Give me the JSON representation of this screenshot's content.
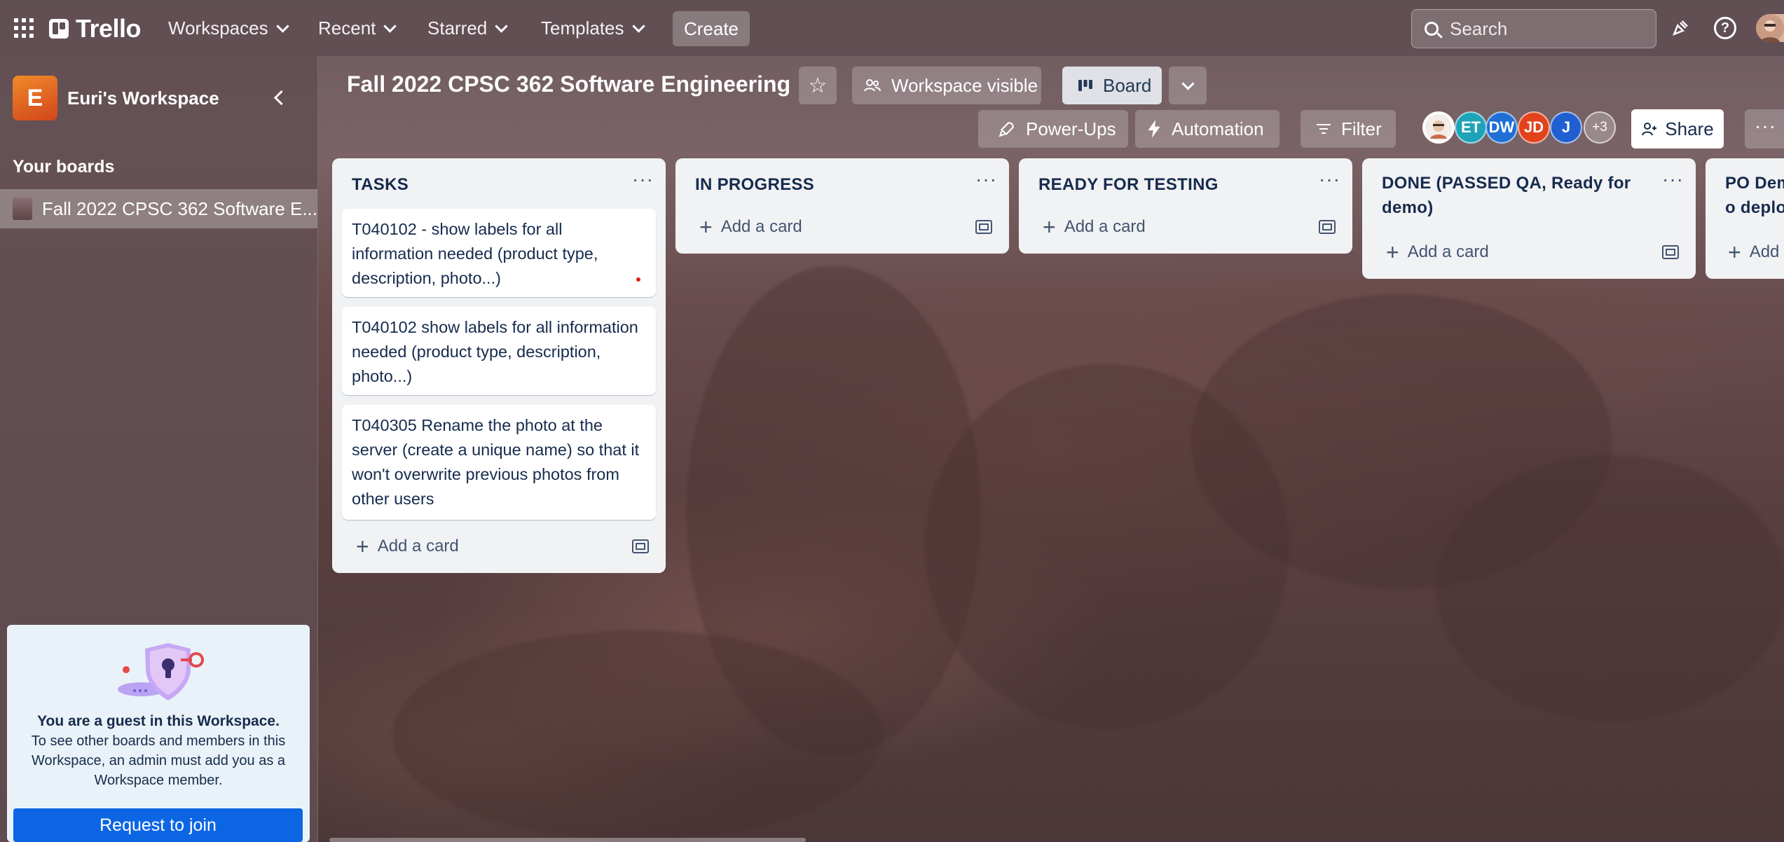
{
  "topnav": {
    "logo_text": "Trello",
    "menus": [
      "Workspaces",
      "Recent",
      "Starred",
      "Templates"
    ],
    "create_label": "Create",
    "search_placeholder": "Search",
    "help_glyph": "?"
  },
  "sidebar": {
    "workspace_initial": "E",
    "workspace_name": "Euri's Workspace",
    "your_boards_label": "Your boards",
    "boards": [
      {
        "title": "Fall 2022 CPSC 362 Software E..."
      }
    ],
    "guest": {
      "title": "You are a guest in this Workspace.",
      "text": "To see other boards and members in this Workspace, an admin must add you as a Workspace member.",
      "button_label": "Request to join"
    }
  },
  "board": {
    "title": "Fall 2022 CPSC 362 Software Engineering",
    "visibility_label": "Workspace visible",
    "view_label": "Board",
    "powerups_label": "Power-Ups",
    "automation_label": "Automation",
    "filter_label": "Filter",
    "members": [
      {
        "initials": "",
        "color": "#e8c8b3"
      },
      {
        "initials": "ET",
        "color": "#1fa3b8"
      },
      {
        "initials": "DW",
        "color": "#1f6fd6"
      },
      {
        "initials": "JD",
        "color": "#e2431c"
      },
      {
        "initials": "J",
        "color": "#1f5fd1"
      }
    ],
    "more_members_label": "+3",
    "share_label": "Share"
  },
  "lists": [
    {
      "title": "TASKS",
      "cards": [
        "T040102 - show labels for all information needed (product type, description, photo...)",
        "T040102 show labels for all information needed (product type, description, photo...)",
        "T040305 Rename the photo at the server (create a unique name) so that it won't overwrite previous photos from other users"
      ],
      "add_label": "Add a card"
    },
    {
      "title": "IN PROGRESS",
      "cards": [],
      "add_label": "Add a card"
    },
    {
      "title": "READY FOR TESTING",
      "cards": [],
      "add_label": "Add a card"
    },
    {
      "title": "DONE (PASSED QA, Ready for demo)",
      "cards": [],
      "add_label": "Add a card"
    },
    {
      "title": "PO Demo deploym",
      "cards": [],
      "add_label": "Add"
    }
  ],
  "colors": {
    "accent": "#0c66e4",
    "workspace_badge": "#e0531e",
    "list_bg": "#f1f2f4"
  }
}
